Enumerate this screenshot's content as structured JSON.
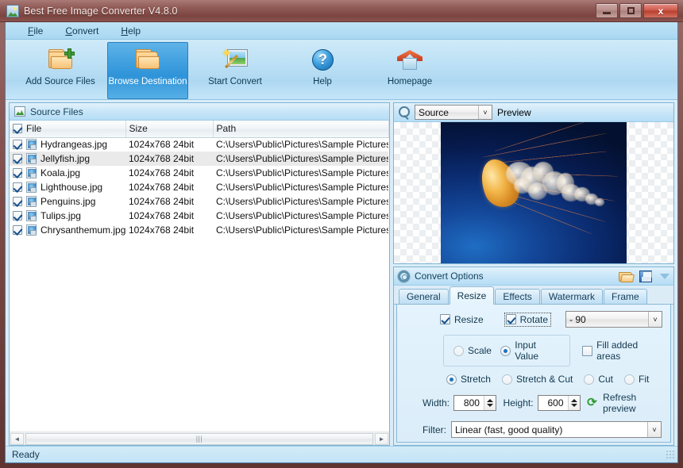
{
  "window": {
    "title": "Best Free Image Converter V4.8.0",
    "app_icon": "image-app-icon",
    "minimize": "–",
    "maximize": "□",
    "close": "x"
  },
  "menubar": {
    "items": [
      {
        "label": "File",
        "accel": "F"
      },
      {
        "label": "Convert",
        "accel": "C"
      },
      {
        "label": "Help",
        "accel": "H"
      }
    ]
  },
  "toolbar": {
    "buttons": [
      {
        "label": "Add Source Files",
        "icon": "folder-plus-icon",
        "active": false
      },
      {
        "label": "Browse Destination",
        "icon": "folder-icon",
        "active": true
      },
      {
        "label": "Start Convert",
        "icon": "magic-wand-image-icon",
        "active": false
      },
      {
        "label": "Help",
        "icon": "question-circle-icon",
        "active": false
      },
      {
        "label": "Homepage",
        "icon": "home-icon",
        "active": false
      }
    ]
  },
  "source_files": {
    "panel_title": "Source Files",
    "panel_icon": "image-chart-icon",
    "columns": [
      "File",
      "Size",
      "Path"
    ],
    "header_checkbox_checked": true,
    "rows": [
      {
        "checked": true,
        "file": "Hydrangeas.jpg",
        "size": "1024x768  24bit",
        "path": "C:\\Users\\Public\\Pictures\\Sample Pictures\\",
        "selected": false
      },
      {
        "checked": true,
        "file": "Jellyfish.jpg",
        "size": "1024x768  24bit",
        "path": "C:\\Users\\Public\\Pictures\\Sample Pictures\\",
        "selected": true
      },
      {
        "checked": true,
        "file": "Koala.jpg",
        "size": "1024x768  24bit",
        "path": "C:\\Users\\Public\\Pictures\\Sample Pictures\\",
        "selected": false
      },
      {
        "checked": true,
        "file": "Lighthouse.jpg",
        "size": "1024x768  24bit",
        "path": "C:\\Users\\Public\\Pictures\\Sample Pictures\\",
        "selected": false
      },
      {
        "checked": true,
        "file": "Penguins.jpg",
        "size": "1024x768  24bit",
        "path": "C:\\Users\\Public\\Pictures\\Sample Pictures\\",
        "selected": false
      },
      {
        "checked": true,
        "file": "Tulips.jpg",
        "size": "1024x768  24bit",
        "path": "C:\\Users\\Public\\Pictures\\Sample Pictures\\",
        "selected": false
      },
      {
        "checked": true,
        "file": "Chrysanthemum.jpg",
        "size": "1024x768  24bit",
        "path": "C:\\Users\\Public\\Pictures\\Sample Pictures\\",
        "selected": false
      }
    ],
    "scrollbar": {
      "left_arrow": "◄",
      "right_arrow": "►",
      "thumb_grip": "|||"
    }
  },
  "preview": {
    "magnifier_icon": "magnifier-icon",
    "mode_value": "Source",
    "mode_arrow": "˅",
    "label": "Preview",
    "image_subject": "jellyfish-photo"
  },
  "convert_options": {
    "title": "Convert Options",
    "gear_icon": "gear-icon",
    "load_icon": "open-folder-icon",
    "save_icon": "save-disk-icon",
    "more_icon": "chevron-down-icon",
    "tabs": [
      {
        "label": "General",
        "active": false
      },
      {
        "label": "Resize",
        "active": true
      },
      {
        "label": "Effects",
        "active": false
      },
      {
        "label": "Watermark",
        "active": false
      },
      {
        "label": "Frame",
        "active": false
      }
    ],
    "resize_panel": {
      "resize_checkbox": {
        "label": "Resize",
        "checked": true
      },
      "rotate_checkbox": {
        "label": "Rotate",
        "checked": true,
        "focused": true
      },
      "rotate_value": "- 90",
      "rotate_arrow": "˅",
      "mode_radios": [
        {
          "label": "Scale",
          "selected": false
        },
        {
          "label": "Input Value",
          "selected": true
        }
      ],
      "fill_added_areas": {
        "label": "Fill added areas",
        "checked": false
      },
      "fit_radios": [
        {
          "label": "Stretch",
          "selected": true
        },
        {
          "label": "Stretch & Cut",
          "selected": false
        },
        {
          "label": "Cut",
          "selected": false
        },
        {
          "label": "Fit",
          "selected": false
        }
      ],
      "width": {
        "label": "Width:",
        "value": "800"
      },
      "height": {
        "label": "Height:",
        "value": "600"
      },
      "refresh_preview": {
        "label": "Refresh preview",
        "icon": "refresh-icon"
      },
      "filter": {
        "label": "Filter:",
        "value": "Linear (fast, good quality)",
        "arrow": "˅"
      }
    }
  },
  "statusbar": {
    "text": "Ready"
  },
  "colors": {
    "frame": "#7d4a46",
    "accent_blue": "#2f93d8",
    "panel_bg": "#dcecf7",
    "title_text": "#f3e7e5"
  }
}
